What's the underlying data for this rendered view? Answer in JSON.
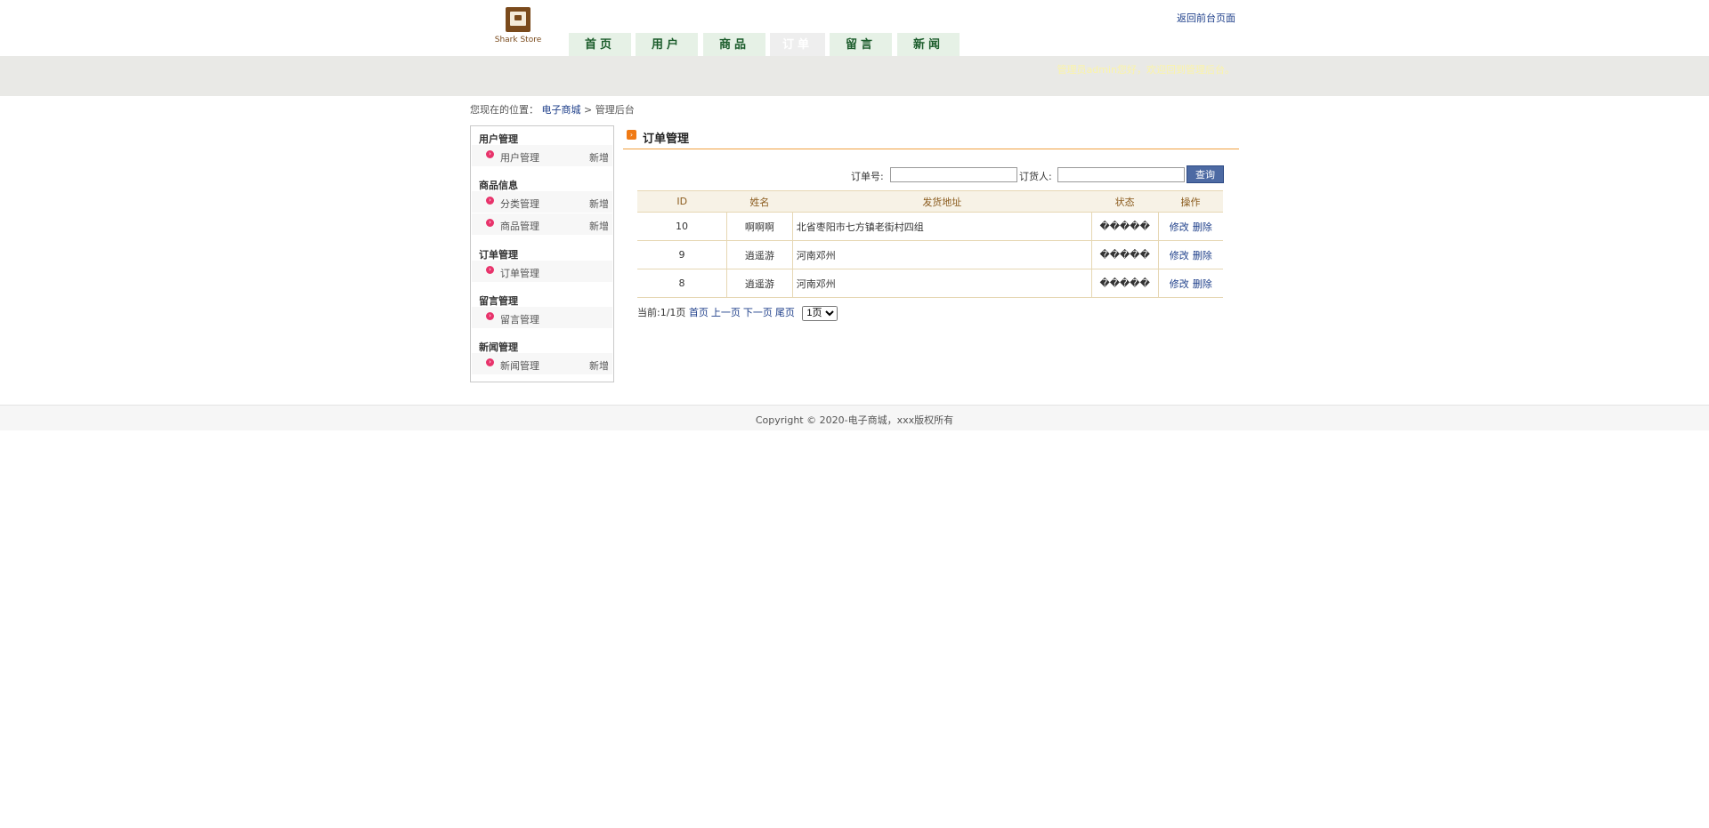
{
  "header": {
    "logo_text": "Shark Store",
    "back_link": "返回前台页面",
    "welcome": "管理员admin您好，欢迎回到管理后台。",
    "tabs": [
      {
        "label": "首页",
        "active": false
      },
      {
        "label": "用户",
        "active": false
      },
      {
        "label": "商品",
        "active": false
      },
      {
        "label": "订单",
        "active": true
      },
      {
        "label": "留言",
        "active": false
      },
      {
        "label": "新闻",
        "active": false
      }
    ]
  },
  "breadcrumb": {
    "prefix": "您现在的位置：",
    "home": "电子商城",
    "separator": ">",
    "current": "管理后台"
  },
  "sidebar": {
    "groups": [
      {
        "title": "用户管理",
        "items": [
          {
            "label": "用户管理",
            "add": "新增"
          }
        ]
      },
      {
        "title": "商品信息",
        "items": [
          {
            "label": "分类管理",
            "add": "新增"
          },
          {
            "label": "商品管理",
            "add": "新增"
          }
        ]
      },
      {
        "title": "订单管理",
        "items": [
          {
            "label": "订单管理",
            "add": ""
          }
        ]
      },
      {
        "title": "留言管理",
        "items": [
          {
            "label": "留言管理",
            "add": ""
          }
        ]
      },
      {
        "title": "新闻管理",
        "items": [
          {
            "label": "新闻管理",
            "add": "新增"
          }
        ]
      }
    ]
  },
  "main": {
    "title": "订单管理",
    "search": {
      "order_no_label": "订单号:",
      "order_no_value": "",
      "customer_label": "订货人:",
      "customer_value": "",
      "button": "查询"
    },
    "table": {
      "headers": [
        "ID",
        "姓名",
        "发货地址",
        "状态",
        "操作"
      ],
      "rows": [
        {
          "id": "10",
          "name": "啊啊啊",
          "address": "北省枣阳市七方镇老街村四组",
          "status": "�����",
          "edit": "修改",
          "delete": "删除"
        },
        {
          "id": "9",
          "name": "逍遥游",
          "address": "河南邓州",
          "status": "�����",
          "edit": "修改",
          "delete": "删除"
        },
        {
          "id": "8",
          "name": "逍遥游",
          "address": "河南邓州",
          "status": "�����",
          "edit": "修改",
          "delete": "删除"
        }
      ]
    },
    "pager": {
      "current": "当前:1/1页",
      "first": "首页",
      "prev": "上一页",
      "next": "下一页",
      "last": "尾页",
      "page_select": "1页"
    }
  },
  "footer": {
    "copyright": "Copyright © 2020-电子商城，xxx版权所有"
  }
}
